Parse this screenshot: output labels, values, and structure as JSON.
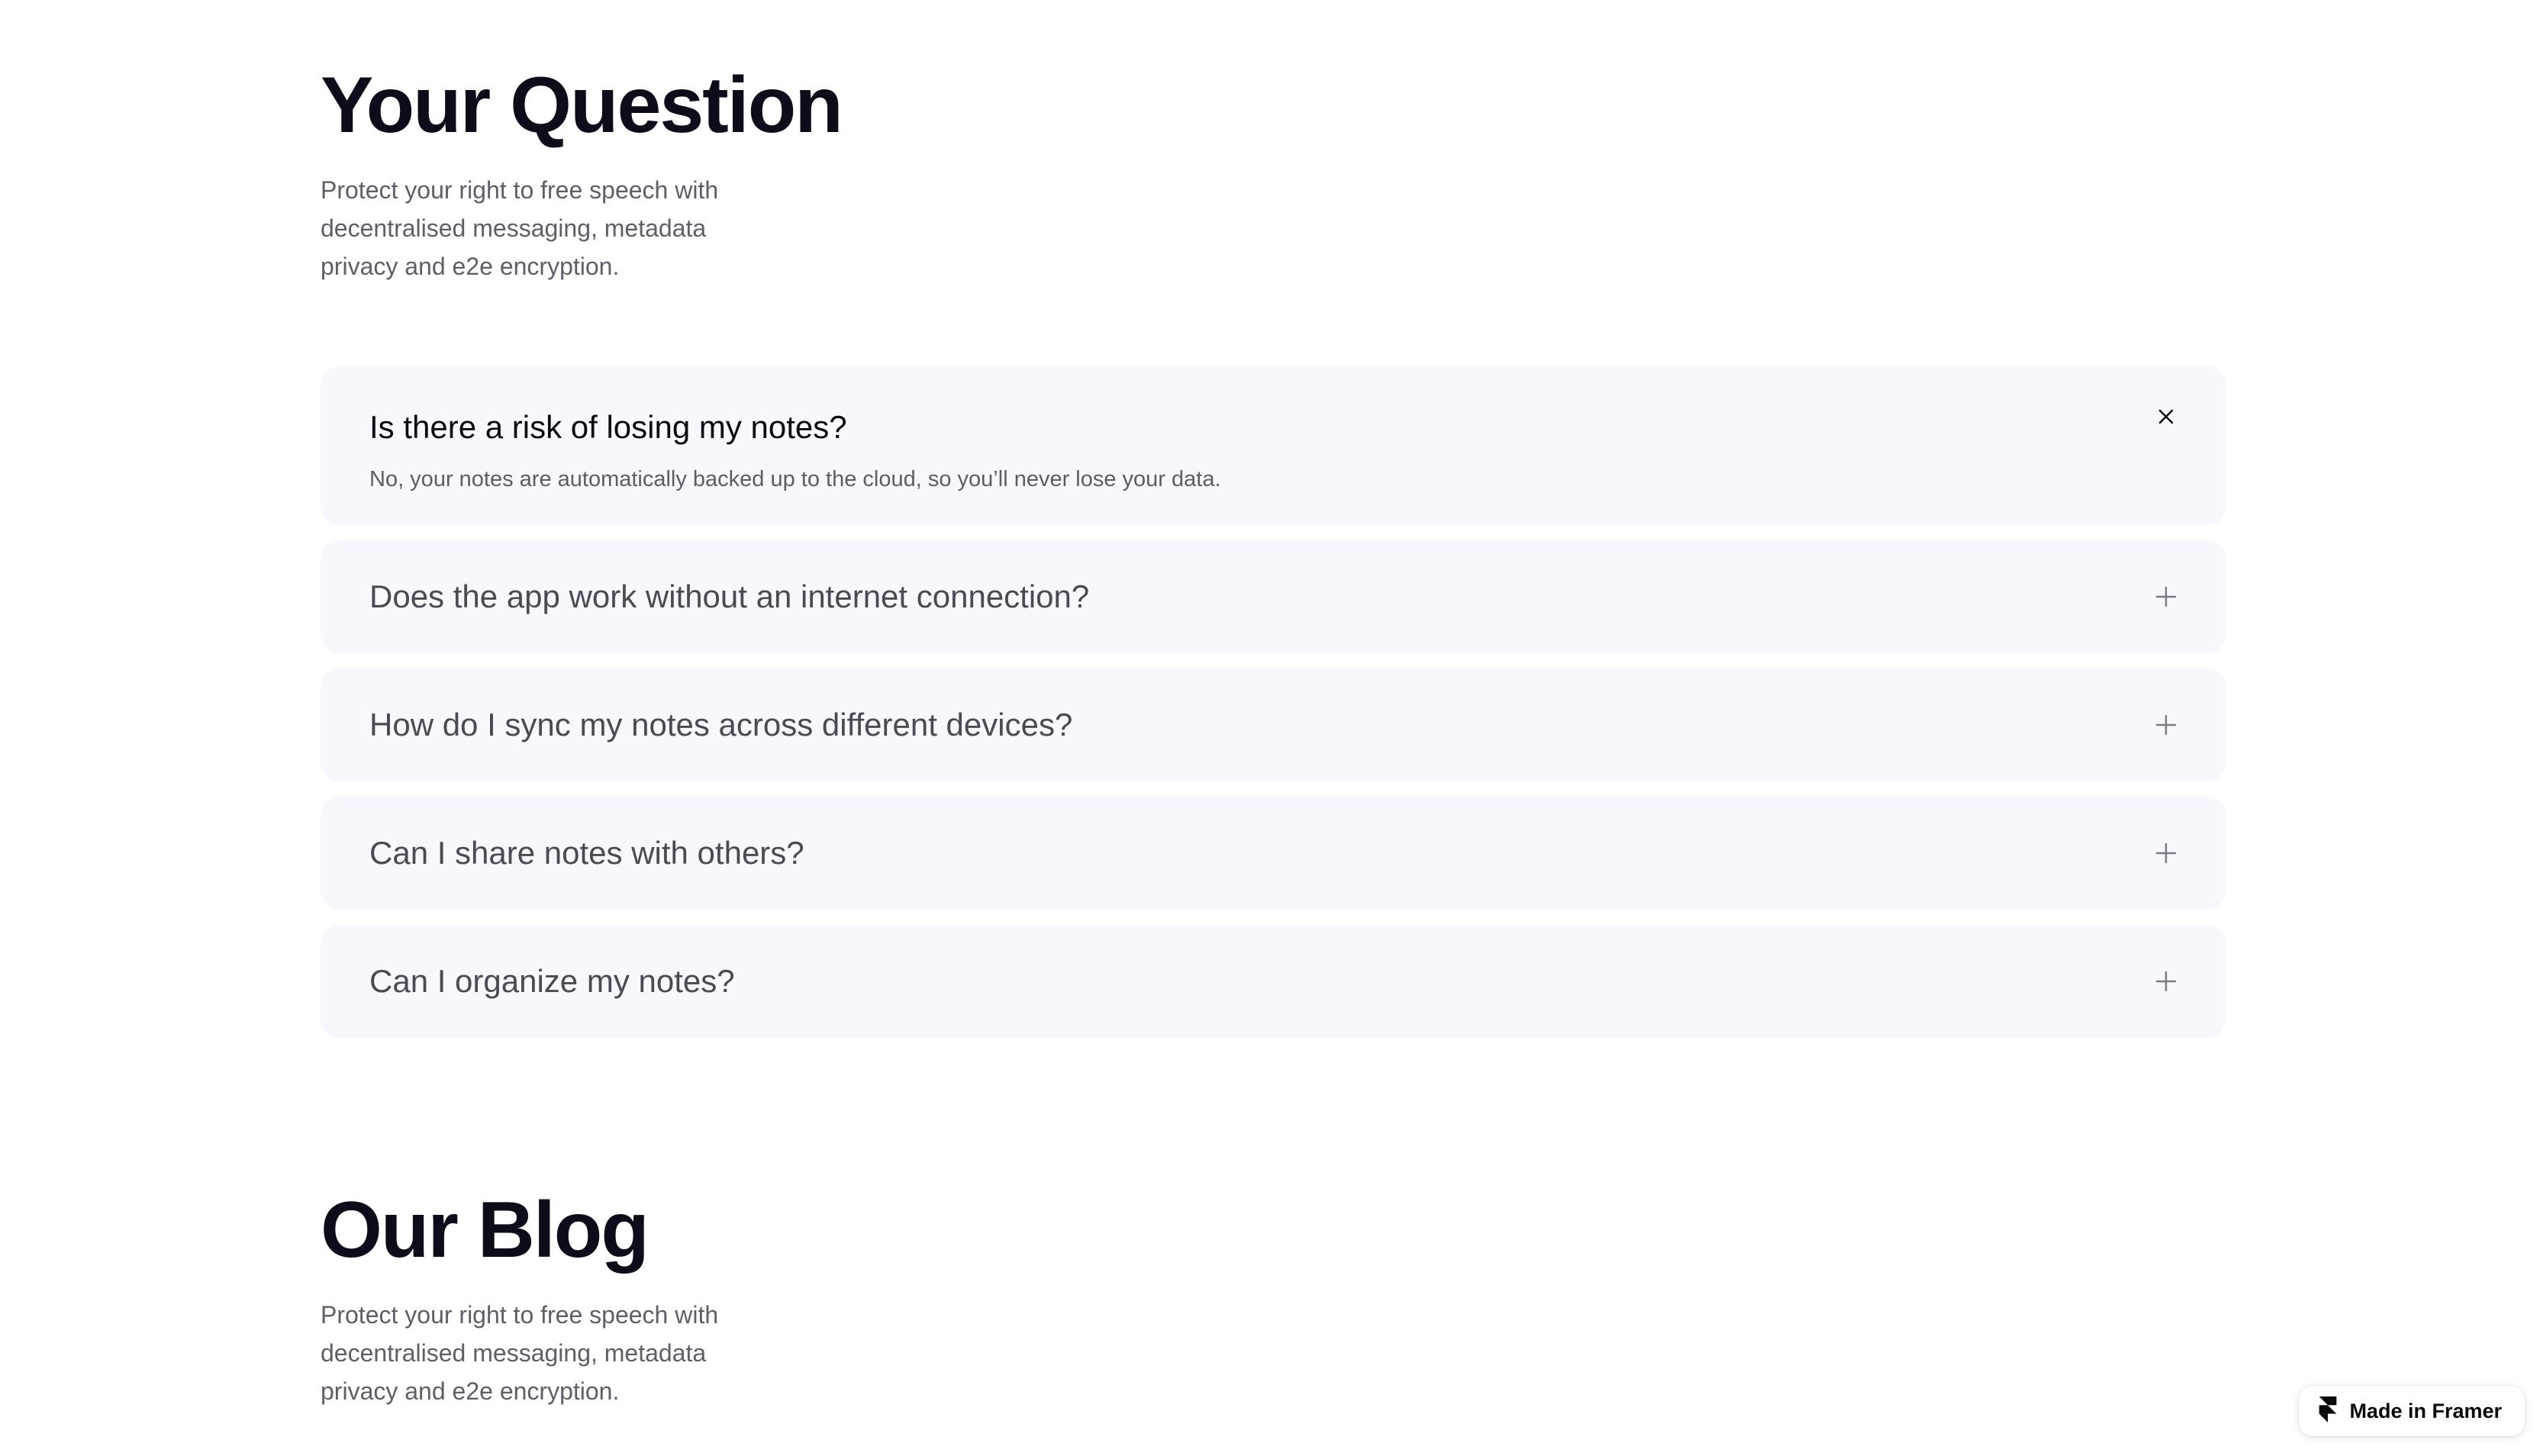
{
  "faq_section": {
    "title": "Your Question",
    "description": "Protect your right to free speech with decentralised messaging, metadata privacy and e2e encryption.",
    "items": [
      {
        "question": "Is there a risk of losing my notes?",
        "answer": "No, your notes are automatically backed up to the cloud, so you’ll never lose your data.",
        "expanded": true,
        "toggle_icon": "close-icon"
      },
      {
        "question": "Does the app work without an internet connection?",
        "expanded": false,
        "toggle_icon": "plus-icon"
      },
      {
        "question": "How do I sync my notes across different devices?",
        "expanded": false,
        "toggle_icon": "plus-icon"
      },
      {
        "question": "Can I share notes with others?",
        "expanded": false,
        "toggle_icon": "plus-icon"
      },
      {
        "question": "Can I organize my notes?",
        "expanded": false,
        "toggle_icon": "plus-icon"
      }
    ]
  },
  "blog_section": {
    "title": "Our Blog",
    "description": "Protect your right to free speech with decentralised messaging, metadata privacy and e2e encryption."
  },
  "badge": {
    "label": "Made in Framer",
    "icon": "framer-logo-icon"
  },
  "colors": {
    "card_background": "#f8f7fd",
    "heading": "#0c0c1a",
    "body_text": "#5e5e6b"
  }
}
